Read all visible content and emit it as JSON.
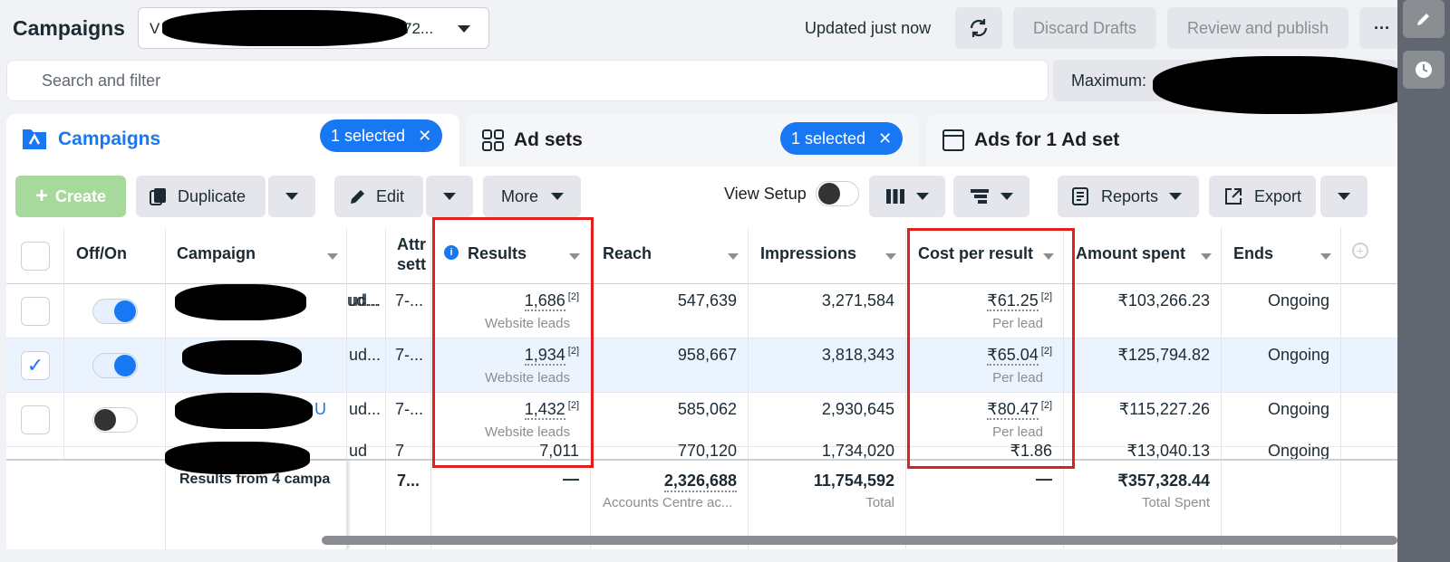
{
  "header": {
    "title": "Campaigns",
    "account_prefix": "V",
    "account_suffix": "72...",
    "updated": "Updated just now",
    "discard": "Discard Drafts",
    "review": "Review and publish",
    "more": "···"
  },
  "search": {
    "placeholder": "Search and filter",
    "maximum_label": "Maximum:"
  },
  "tabs": {
    "campaigns": {
      "label": "Campaigns",
      "selected": "1 selected"
    },
    "adsets": {
      "label": "Ad sets",
      "selected": "1 selected"
    },
    "ads": {
      "label": "Ads for 1 Ad set"
    }
  },
  "toolbar": {
    "create": "Create",
    "duplicate": "Duplicate",
    "edit": "Edit",
    "more": "More",
    "view_setup": "View Setup",
    "reports": "Reports",
    "export": "Export"
  },
  "columns": {
    "off_on": "Off/On",
    "campaign": "Campaign",
    "attr": "Attr",
    "attr2": "sett",
    "results": "Results",
    "reach": "Reach",
    "impressions": "Impressions",
    "cost": "Cost per result",
    "spent": "Amount spent",
    "ends": "Ends"
  },
  "rows": [
    {
      "selected": false,
      "on": true,
      "trunc": "ud...",
      "attr": "7-...",
      "results": "1,686",
      "results_sub": "Website leads",
      "reach": "547,639",
      "impressions": "3,271,584",
      "cost": "₹61.25",
      "cost_sub": "Per lead",
      "spent": "₹103,266.23",
      "ends": "Ongoing",
      "sup": "[2]"
    },
    {
      "selected": true,
      "on": true,
      "trunc": "ud...",
      "attr": "7-...",
      "results": "1,934",
      "results_sub": "Website leads",
      "reach": "958,667",
      "impressions": "3,818,343",
      "cost": "₹65.04",
      "cost_sub": "Per lead",
      "spent": "₹125,794.82",
      "ends": "Ongoing",
      "sup": "[2]"
    },
    {
      "selected": false,
      "on": false,
      "trunc": "ud...",
      "name_tail": "U",
      "attr": "7-...",
      "results": "1,432",
      "results_sub": "Website leads",
      "reach": "585,062",
      "impressions": "2,930,645",
      "cost": "₹80.47",
      "cost_sub": "Per lead",
      "spent": "₹115,227.26",
      "ends": "Ongoing",
      "sup": "[2]"
    },
    {
      "selected": false,
      "on": false,
      "trunc": "ud",
      "attr": "7",
      "results": "7,011",
      "reach": "770,120",
      "impressions": "1,734,020",
      "cost": "₹1.86",
      "spent": "₹13,040.13",
      "ends": "Ongoing"
    }
  ],
  "footer": {
    "label": "Results from 4 campa",
    "attr": "7...",
    "results": "—",
    "reach": "2,326,688",
    "reach_sub": "Accounts Centre ac...",
    "impressions": "11,754,592",
    "impressions_sub": "Total",
    "cost": "—",
    "spent": "₹357,328.44",
    "spent_sub": "Total Spent"
  },
  "colors": {
    "accent": "#1877f2",
    "highlight": "#e02020"
  }
}
